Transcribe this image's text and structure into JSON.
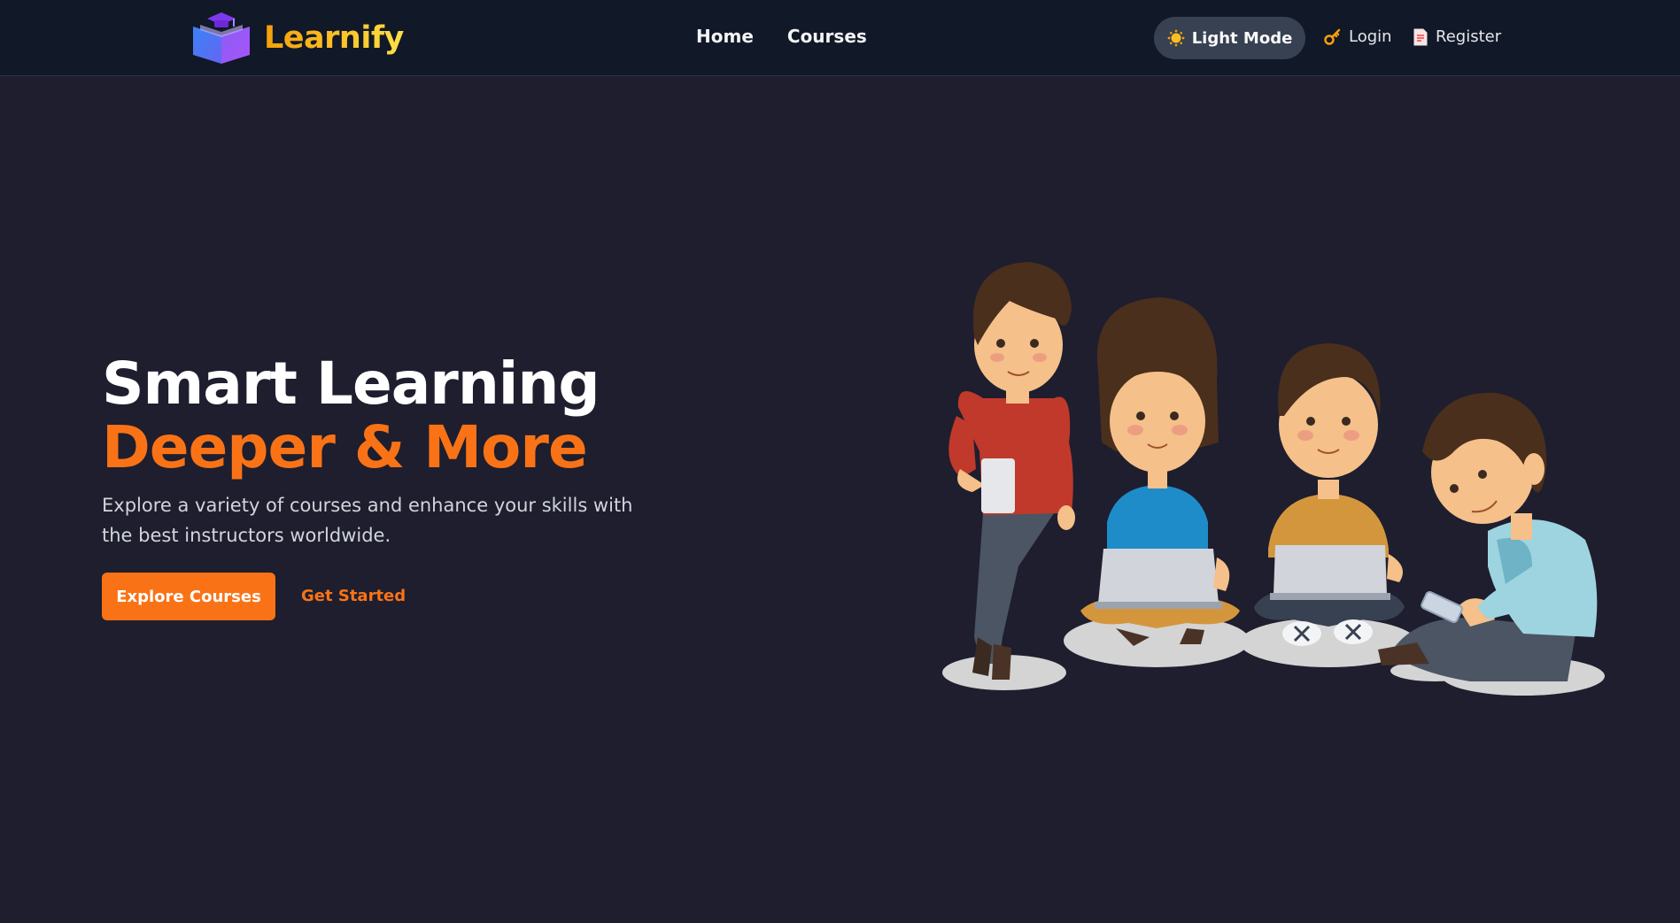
{
  "navbar": {
    "brand": "Learnify",
    "links": [
      {
        "label": "Home"
      },
      {
        "label": "Courses"
      }
    ],
    "theme_toggle": {
      "label": "Light Mode",
      "icon": "sun-icon"
    },
    "login": {
      "label": "Login",
      "icon": "key-icon"
    },
    "register": {
      "label": "Register",
      "icon": "document-icon"
    }
  },
  "hero": {
    "title_line1": "Smart Learning",
    "title_line2": "Deeper & More",
    "description": "Explore a variety of courses and enhance your skills with the best instructors worldwide.",
    "primary_button": "Explore Courses",
    "secondary_link": "Get Started",
    "illustration": "students-learning-illustration"
  },
  "colors": {
    "background": "#1e1e2e",
    "navbar": "#111827",
    "accent": "#f97316",
    "brand_gradient": [
      "#f59e0b",
      "#fde047"
    ]
  }
}
